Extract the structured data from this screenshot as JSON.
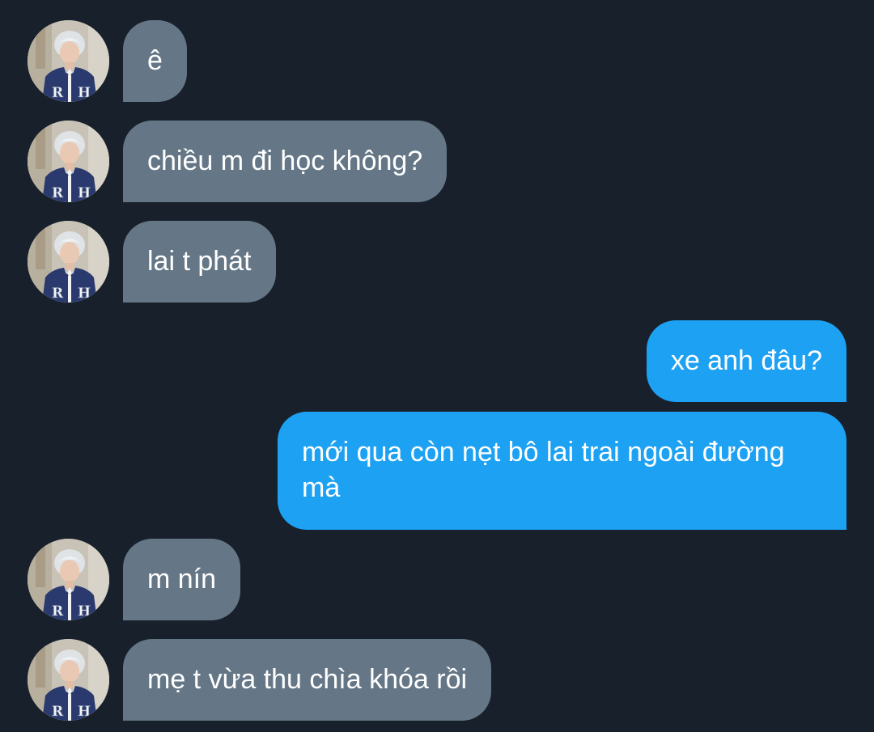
{
  "conversation": {
    "messages": [
      {
        "sender": "other",
        "text": "ê"
      },
      {
        "sender": "other",
        "text": "chiều m đi học không?"
      },
      {
        "sender": "other",
        "text": "lai t phát"
      },
      {
        "sender": "me",
        "text": "xe anh đâu?"
      },
      {
        "sender": "me",
        "text": "mới qua còn nẹt bô lai trai ngoài đường mà"
      },
      {
        "sender": "other",
        "text": "m nín"
      },
      {
        "sender": "other",
        "text": "mẹ t vừa thu chìa khóa rồi"
      }
    ]
  },
  "colors": {
    "background": "#17202b",
    "incoming_bubble": "#657786",
    "outgoing_bubble": "#1da1f2",
    "text": "#ffffff"
  },
  "icons": {
    "contact_avatar": "contact-avatar"
  }
}
